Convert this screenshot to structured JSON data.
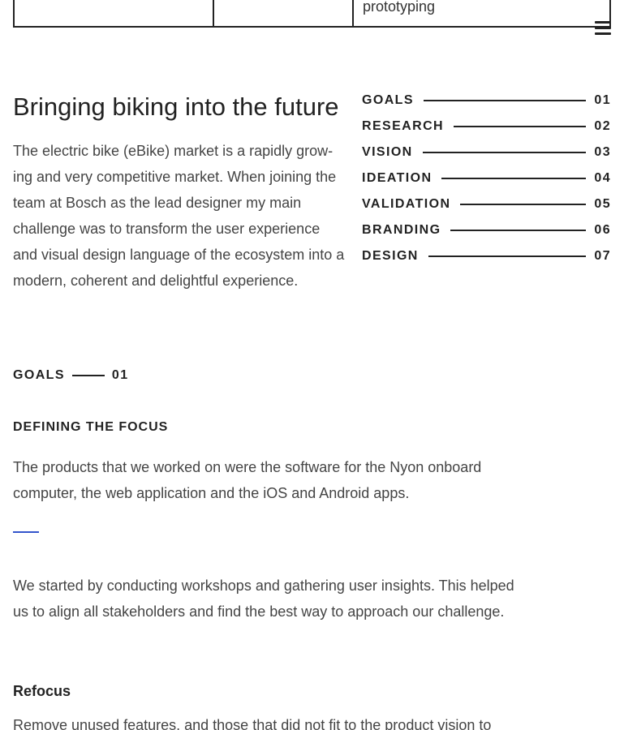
{
  "top_table": {
    "cells": [
      "",
      "",
      "prototyping"
    ]
  },
  "menu": {
    "icon": "hamburger-menu-icon"
  },
  "hero": {
    "title": "Bringing biking into the future",
    "text": "The electric bike (eBike) market is a rapidly grow-ing and very competitive market. When joining the team at Bosch as the lead designer my main challenge was to transform the user experience and visual design language of the ecosystem into a modern, coherent and delightful experience."
  },
  "toc": [
    {
      "label": "GOALS",
      "num": "01"
    },
    {
      "label": "RESEARCH",
      "num": "02"
    },
    {
      "label": "VISION",
      "num": "03"
    },
    {
      "label": "IDEATION",
      "num": "04"
    },
    {
      "label": "VALIDATION",
      "num": "05"
    },
    {
      "label": "BRANDING",
      "num": "06"
    },
    {
      "label": "DESIGN",
      "num": "07"
    }
  ],
  "section": {
    "label": "GOALS",
    "num": "01",
    "heading": "DEFINING THE FOCUS",
    "para1": "The products that we worked on were the software for the Nyon onboard computer, the web application and the iOS and Android apps.",
    "para2": "We started by conducting workshops and gathering user insights. This helped us to align all stakeholders and find the best way to approach our challenge.",
    "subheading": "Refocus",
    "para3": "Remove unused features, and those that did not fit to the product vision to"
  },
  "colors": {
    "text": "#222222",
    "body": "#444444",
    "accent": "#3355cc"
  }
}
